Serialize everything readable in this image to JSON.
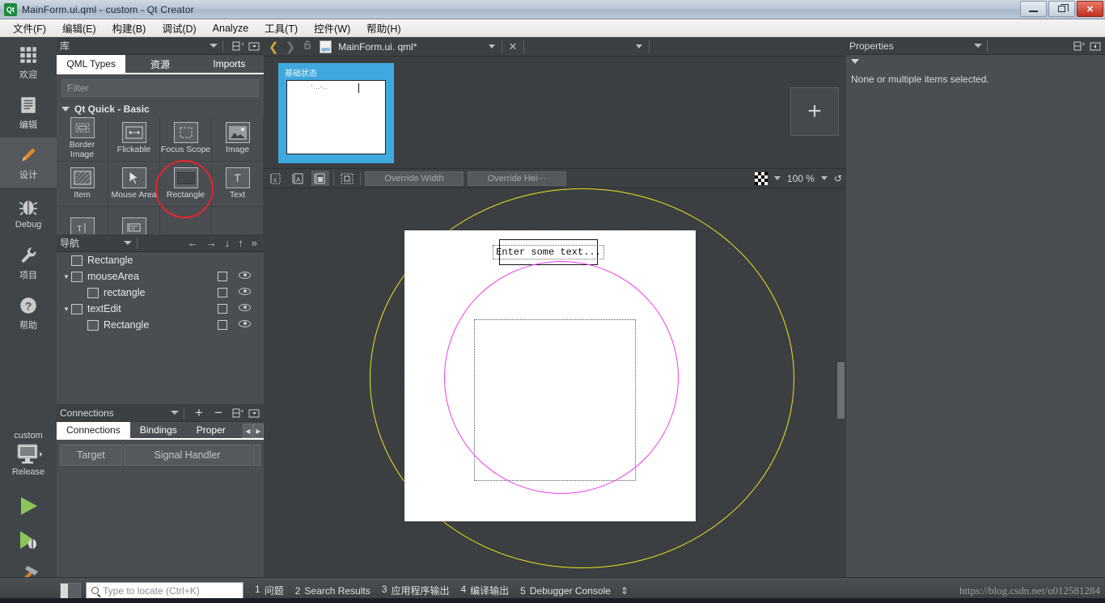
{
  "window": {
    "title": "MainForm.ui.qml - custom - Qt Creator",
    "app_icon": "Qt",
    "minimize_label": "Minimize",
    "restore_label": "Restore",
    "close_label": "✕"
  },
  "menubar": [
    {
      "label": "文件(F)"
    },
    {
      "label": "编辑(E)"
    },
    {
      "label": "构建(B)"
    },
    {
      "label": "调试(D)"
    },
    {
      "label": "Analyze"
    },
    {
      "label": "工具(T)"
    },
    {
      "label": "控件(W)"
    },
    {
      "label": "帮助(H)"
    }
  ],
  "modebar": [
    {
      "label": "欢迎",
      "icon": "grid-icon",
      "active": false
    },
    {
      "label": "编辑",
      "icon": "document-icon",
      "active": false
    },
    {
      "label": "设计",
      "icon": "pencil-icon",
      "active": true
    },
    {
      "label": "Debug",
      "icon": "bug-icon",
      "active": false
    },
    {
      "label": "项目",
      "icon": "wrench-icon",
      "active": false
    },
    {
      "label": "帮助",
      "icon": "question-icon",
      "active": false
    }
  ],
  "kit": {
    "project_name": "custom",
    "build_config": "Release",
    "run_label": "run-icon",
    "debug_label": "debug-icon",
    "build_label": "build-icon"
  },
  "library": {
    "title": "库",
    "tabs": [
      {
        "label": "QML Types",
        "active": true
      },
      {
        "label": "资源",
        "active": false
      },
      {
        "label": "Imports",
        "active": false
      }
    ],
    "filter_placeholder": "Filter",
    "section": "Qt Quick - Basic",
    "items": [
      {
        "label": "Border Image",
        "icon": "border-image-icon"
      },
      {
        "label": "Flickable",
        "icon": "flickable-icon"
      },
      {
        "label": "Focus Scope",
        "icon": "focus-scope-icon"
      },
      {
        "label": "Image",
        "icon": "image-icon"
      },
      {
        "label": "Item",
        "icon": "item-icon"
      },
      {
        "label": "Mouse Area",
        "icon": "mouse-area-icon"
      },
      {
        "label": "Rectangle",
        "icon": "rectangle-icon",
        "highlighted": true
      },
      {
        "label": "Text",
        "icon": "text-icon"
      },
      {
        "label": "",
        "icon": "text-edit-icon"
      },
      {
        "label": "",
        "icon": "text-input-icon"
      }
    ]
  },
  "navigator": {
    "title": "导航",
    "rows": [
      {
        "label": "Rectangle",
        "depth": 0,
        "twisty": "",
        "icon": "rectangle-icon",
        "has_actions": false
      },
      {
        "label": "mouseArea",
        "depth": 0,
        "twisty": "▼",
        "icon": "mouse-area-icon",
        "has_actions": true
      },
      {
        "label": "rectangle",
        "depth": 1,
        "twisty": "",
        "icon": "rectangle-icon",
        "has_actions": true
      },
      {
        "label": "textEdit",
        "depth": 0,
        "twisty": "▼",
        "icon": "text-edit-icon",
        "has_actions": true
      },
      {
        "label": "Rectangle",
        "depth": 1,
        "twisty": "",
        "icon": "rectangle-icon",
        "has_actions": true
      }
    ]
  },
  "connections": {
    "title": "Connections",
    "tabs": [
      {
        "label": "Connections",
        "active": true
      },
      {
        "label": "Bindings",
        "active": false
      },
      {
        "label": "Proper",
        "active": false
      }
    ],
    "columns": [
      "Target",
      "Signal Handler"
    ],
    "add_label": "+",
    "remove_label": "−"
  },
  "designer": {
    "file_name": "MainForm.ui. qml*",
    "back_label": "❮",
    "forward_label": "❯",
    "lock_label": "lock-icon",
    "close_label": "✕",
    "states": [
      {
        "label": "基础状态",
        "preview_text": "'...-..",
        "active": true
      }
    ],
    "add_state_label": "+",
    "toolbar": {
      "buttons": [
        "no-anchors-icon",
        "anchors-a-icon",
        "anchors-fill-icon",
        "select-all-icon"
      ],
      "override_width_placeholder": "Override Width",
      "override_height_placeholder": "Override Hei···",
      "background_label": "checker-icon",
      "zoom_value": "100 %",
      "reset_label": "reset-icon"
    },
    "canvas": {
      "text_edit_value": "Enter some text...",
      "yellow_circle_color": "#e8e816",
      "magenta_circle_color": "#f03cf0",
      "form_background": "#ffffff"
    }
  },
  "properties": {
    "title": "Properties",
    "message": "None or multiple items selected."
  },
  "statusbar": {
    "search_placeholder": "Type to locate (Ctrl+K)",
    "outputs": [
      {
        "num": "1",
        "label": "问题"
      },
      {
        "num": "2",
        "label": "Search Results"
      },
      {
        "num": "3",
        "label": "应用程序输出"
      },
      {
        "num": "4",
        "label": "编译输出"
      },
      {
        "num": "5",
        "label": "Debugger Console"
      }
    ],
    "watermark": "https://blog.csdn.net/u012581284"
  }
}
